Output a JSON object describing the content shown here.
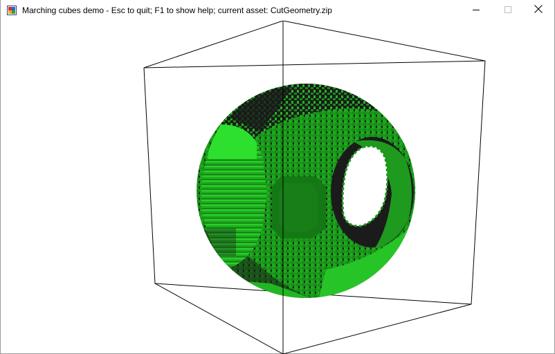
{
  "window": {
    "title": "Marching cubes demo - Esc to quit; F1 to show help; current asset: CutGeometry.zip",
    "icon": "app-icon",
    "buttons": {
      "minimize_icon": "minimize-icon",
      "maximize_icon": "maximize-icon",
      "close_icon": "close-icon"
    }
  },
  "scene": {
    "background_color": "#ffffff",
    "bounding_box_color": "#000000",
    "mesh_colors": {
      "base": "#1a9a1a",
      "light": "#28d428",
      "mid": "#1eaa1e",
      "dark": "#1a1a1a",
      "shade": "#147814"
    },
    "object": "voxel-sphere-with-cylindrical-cuts"
  }
}
